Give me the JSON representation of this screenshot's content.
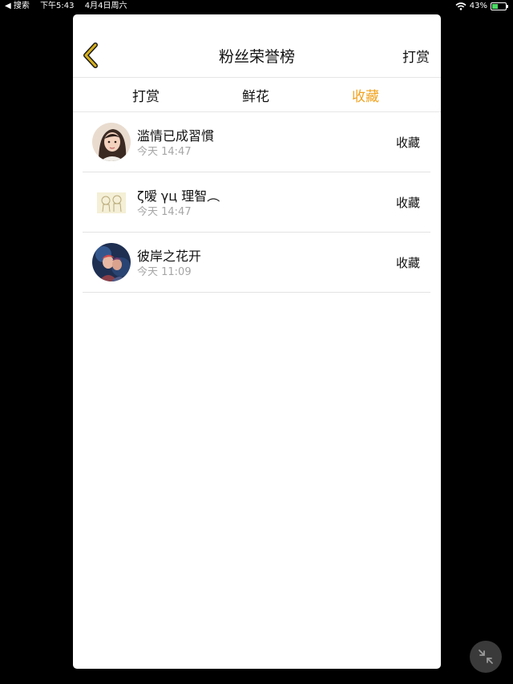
{
  "status_bar": {
    "back_app": "◀ 搜索",
    "time": "下午5:43",
    "date": "4月4日周六",
    "battery": "43%",
    "icons": [
      "wifi-icon",
      "battery-icon"
    ]
  },
  "header": {
    "title": "粉丝荣誉榜",
    "action": "打赏",
    "back_icon": "chevron-left-icon",
    "back_color": "#d6b01c"
  },
  "tabs": [
    {
      "label": "打赏",
      "active": false
    },
    {
      "label": "鲜花",
      "active": false
    },
    {
      "label": "收藏",
      "active": true
    }
  ],
  "accent_color": "#f0a21e",
  "list": [
    {
      "name": "滥情已成習慣",
      "time": "今天 14:47",
      "action": "收藏"
    },
    {
      "name": "ζ嗳 γц 理智︵",
      "time": "今天 14:47",
      "action": "收藏"
    },
    {
      "name": "彼岸之花开",
      "time": "今天 11:09",
      "action": "收藏"
    }
  ],
  "float_button_icon": "collapse-arrows-icon"
}
